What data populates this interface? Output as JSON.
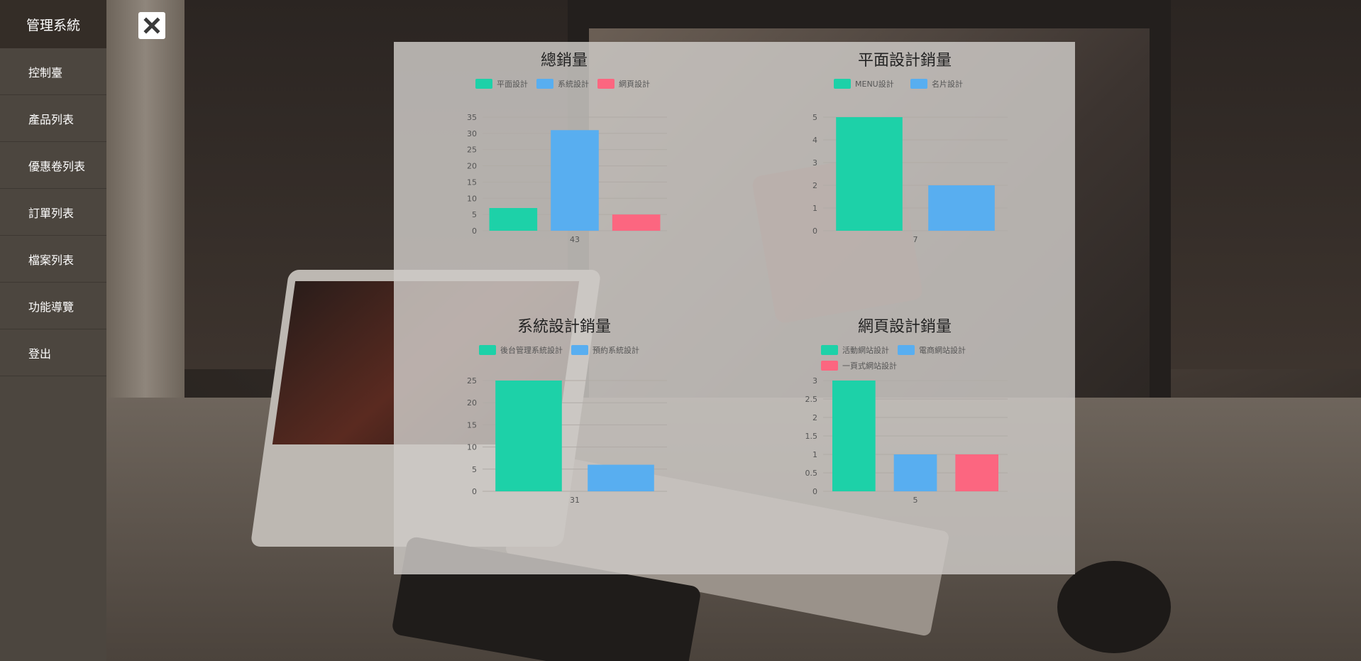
{
  "app": {
    "title": "管理系統"
  },
  "sidebar": {
    "items": [
      {
        "label": "控制臺"
      },
      {
        "label": "產品列表"
      },
      {
        "label": "優惠卷列表"
      },
      {
        "label": "訂單列表"
      },
      {
        "label": "檔案列表"
      },
      {
        "label": "功能導覽"
      },
      {
        "label": "登出"
      }
    ]
  },
  "close_icon": "close-icon",
  "colors": {
    "green": "#1dd1a8",
    "blue": "#58aef0",
    "red": "#fc6680"
  },
  "chart_data": [
    {
      "type": "bar",
      "title": "總銷量",
      "categories": [
        "43"
      ],
      "series": [
        {
          "name": "平面設計",
          "color": "#1dd1a8",
          "values": [
            7
          ]
        },
        {
          "name": "系統設計",
          "color": "#58aef0",
          "values": [
            31
          ]
        },
        {
          "name": "網頁設計",
          "color": "#fc6680",
          "values": [
            5
          ]
        }
      ],
      "ylim": [
        0,
        35
      ],
      "yticks": [
        0,
        5,
        10,
        15,
        20,
        25,
        30,
        35
      ],
      "grid": true,
      "legend": "top"
    },
    {
      "type": "bar",
      "title": "平面設計銷量",
      "categories": [
        "7"
      ],
      "series": [
        {
          "name": "MENU設計",
          "color": "#1dd1a8",
          "values": [
            5
          ]
        },
        {
          "name": "名片設計",
          "color": "#58aef0",
          "values": [
            2
          ]
        }
      ],
      "ylim": [
        0,
        5
      ],
      "yticks": [
        0,
        1,
        2,
        3,
        4,
        5
      ],
      "grid": true,
      "legend": "top"
    },
    {
      "type": "bar",
      "title": "系統設計銷量",
      "categories": [
        "31"
      ],
      "series": [
        {
          "name": "後台管理系統設計",
          "color": "#1dd1a8",
          "values": [
            25
          ]
        },
        {
          "name": "預約系統設計",
          "color": "#58aef0",
          "values": [
            6
          ]
        }
      ],
      "ylim": [
        0,
        25
      ],
      "yticks": [
        0,
        5,
        10,
        15,
        20,
        25
      ],
      "grid": true,
      "legend": "top"
    },
    {
      "type": "bar",
      "title": "網頁設計銷量",
      "categories": [
        "5"
      ],
      "series": [
        {
          "name": "活動網站設計",
          "color": "#1dd1a8",
          "values": [
            3
          ]
        },
        {
          "name": "電商網站設計",
          "color": "#58aef0",
          "values": [
            1
          ]
        },
        {
          "name": "一頁式網站設計",
          "color": "#fc6680",
          "values": [
            1
          ]
        }
      ],
      "ylim": [
        0,
        3
      ],
      "yticks": [
        0,
        0.5,
        1,
        1.5,
        2,
        2.5,
        3
      ],
      "grid": true,
      "legend": "top"
    }
  ]
}
